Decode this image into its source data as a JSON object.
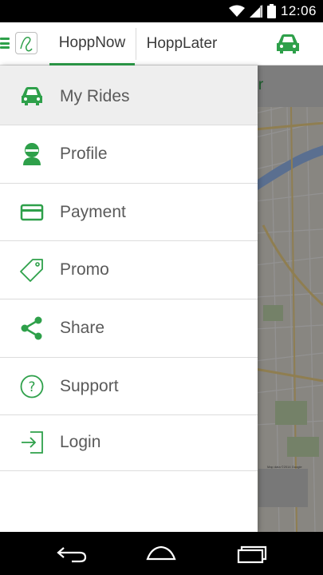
{
  "status_bar": {
    "time": "12:06",
    "icons": [
      "wifi-icon",
      "cell-signal-icon",
      "battery-icon"
    ]
  },
  "app_bar": {
    "tabs": [
      {
        "label": "HoppNow",
        "selected": true
      },
      {
        "label": "HoppLater",
        "selected": false
      }
    ],
    "right_icon": "car-icon"
  },
  "map": {
    "tab_fragment": "ter",
    "attribution": "Map data ©2014 Google"
  },
  "drawer": {
    "items": [
      {
        "label": "My Rides",
        "icon": "car-icon",
        "active": true
      },
      {
        "label": "Profile",
        "icon": "person-icon",
        "active": false
      },
      {
        "label": "Payment",
        "icon": "credit-card-icon",
        "active": false
      },
      {
        "label": "Promo",
        "icon": "tag-icon",
        "active": false
      },
      {
        "label": "Share",
        "icon": "share-icon",
        "active": false
      },
      {
        "label": "Support",
        "icon": "help-circle-icon",
        "active": false
      },
      {
        "label": "Login",
        "icon": "login-icon",
        "active": false
      }
    ]
  },
  "nav_bar": {
    "buttons": [
      "back-icon",
      "home-icon",
      "recents-icon"
    ]
  },
  "colors": {
    "accent": "#2ea04a",
    "text": "#5a5a5a",
    "divider": "#dcdcdc",
    "active_row": "#eeeeee"
  }
}
